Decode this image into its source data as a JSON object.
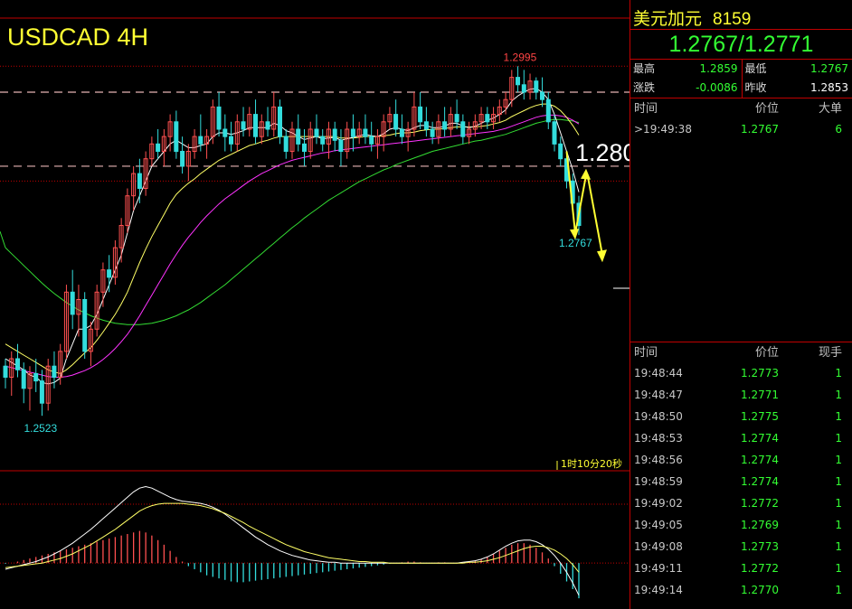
{
  "chart_title": "USDCAD 4H",
  "panel": {
    "name": "美元加元",
    "code": "8159",
    "price": "1.2767/1.2771",
    "stats": [
      [
        {
          "label": "最高",
          "value": "1.2859",
          "color": "green"
        },
        {
          "label": "最低",
          "value": "1.2767",
          "color": "green"
        }
      ],
      [
        {
          "label": "涨跌",
          "value": "-0.0086",
          "color": "green"
        },
        {
          "label": "昨收",
          "value": "1.2853",
          "color": "white"
        }
      ]
    ],
    "quote_header": [
      "时间",
      "价位",
      "大单"
    ],
    "quote_rows": [
      {
        "time": ">19:49:38",
        "price": "1.2767",
        "vol": "6"
      }
    ],
    "tick_header": [
      "时间",
      "价位",
      "现手"
    ],
    "ticks": [
      {
        "time": "19:48:44",
        "price": "1.2773",
        "vol": "1"
      },
      {
        "time": "19:48:47",
        "price": "1.2771",
        "vol": "1"
      },
      {
        "time": "19:48:50",
        "price": "1.2775",
        "vol": "1"
      },
      {
        "time": "19:48:53",
        "price": "1.2774",
        "vol": "1"
      },
      {
        "time": "19:48:56",
        "price": "1.2774",
        "vol": "1"
      },
      {
        "time": "19:48:59",
        "price": "1.2774",
        "vol": "1"
      },
      {
        "time": "19:49:02",
        "price": "1.2772",
        "vol": "1"
      },
      {
        "time": "19:49:05",
        "price": "1.2769",
        "vol": "1"
      },
      {
        "time": "19:49:08",
        "price": "1.2773",
        "vol": "1"
      },
      {
        "time": "19:49:11",
        "price": "1.2772",
        "vol": "1"
      },
      {
        "time": "19:49:14",
        "price": "1.2770",
        "vol": "1"
      }
    ]
  },
  "chart_data": {
    "type": "candlestick",
    "symbol": "USDCAD",
    "timeframe": "4H",
    "ylim": [
      1.245,
      1.306
    ],
    "high_label": "1.2995",
    "low_label": "1.2523",
    "last_label": "1.2767",
    "level_label": "1.2800",
    "countdown": "1时10分20秒",
    "levels": [
      1.296,
      1.286
    ],
    "ref_line": 1.284,
    "colors": {
      "up": "#ff5050",
      "down": "#33dddd",
      "ma_fast": "#ffffff",
      "ma_mid": "#ffff66",
      "ma_slow": "#ff33ff",
      "ma_long": "#33dd33",
      "grid": "#c00000",
      "level": "#e6b3b3",
      "arrow": "#ffff33"
    },
    "candles": [
      [
        1.259,
        1.26,
        1.256,
        1.2575
      ],
      [
        1.2575,
        1.261,
        1.255,
        1.26
      ],
      [
        1.26,
        1.262,
        1.2575,
        1.2585
      ],
      [
        1.2585,
        1.2595,
        1.254,
        1.256
      ],
      [
        1.256,
        1.259,
        1.253,
        1.258
      ],
      [
        1.258,
        1.26,
        1.2555,
        1.257
      ],
      [
        1.257,
        1.2585,
        1.2523,
        1.254
      ],
      [
        1.254,
        1.26,
        1.253,
        1.259
      ],
      [
        1.259,
        1.261,
        1.256,
        1.2575
      ],
      [
        1.2575,
        1.262,
        1.2565,
        1.261
      ],
      [
        1.261,
        1.27,
        1.26,
        1.269
      ],
      [
        1.269,
        1.272,
        1.264,
        1.266
      ],
      [
        1.266,
        1.27,
        1.263,
        1.268
      ],
      [
        1.268,
        1.269,
        1.26,
        1.261
      ],
      [
        1.261,
        1.265,
        1.259,
        1.264
      ],
      [
        1.264,
        1.27,
        1.263,
        1.269
      ],
      [
        1.269,
        1.273,
        1.267,
        1.272
      ],
      [
        1.272,
        1.274,
        1.269,
        1.271
      ],
      [
        1.271,
        1.276,
        1.27,
        1.275
      ],
      [
        1.275,
        1.279,
        1.273,
        1.278
      ],
      [
        1.278,
        1.283,
        1.277,
        1.282
      ],
      [
        1.282,
        1.286,
        1.28,
        1.285
      ],
      [
        1.285,
        1.287,
        1.281,
        1.283
      ],
      [
        1.283,
        1.288,
        1.282,
        1.287
      ],
      [
        1.287,
        1.29,
        1.286,
        1.289
      ],
      [
        1.289,
        1.291,
        1.287,
        1.288
      ],
      [
        1.288,
        1.291,
        1.286,
        1.29
      ],
      [
        1.29,
        1.293,
        1.288,
        1.292
      ],
      [
        1.292,
        1.2935,
        1.287,
        1.288
      ],
      [
        1.288,
        1.29,
        1.285,
        1.286
      ],
      [
        1.286,
        1.289,
        1.284,
        1.288
      ],
      [
        1.288,
        1.291,
        1.287,
        1.29
      ],
      [
        1.29,
        1.293,
        1.288,
        1.289
      ],
      [
        1.289,
        1.291,
        1.287,
        1.29
      ],
      [
        1.29,
        1.295,
        1.289,
        1.294
      ],
      [
        1.294,
        1.296,
        1.29,
        1.291
      ],
      [
        1.291,
        1.293,
        1.288,
        1.29
      ],
      [
        1.29,
        1.292,
        1.288,
        1.289
      ],
      [
        1.289,
        1.293,
        1.288,
        1.292
      ],
      [
        1.292,
        1.294,
        1.29,
        1.291
      ],
      [
        1.291,
        1.294,
        1.29,
        1.293
      ],
      [
        1.293,
        1.295,
        1.289,
        1.29
      ],
      [
        1.29,
        1.293,
        1.289,
        1.292
      ],
      [
        1.292,
        1.294,
        1.29,
        1.291
      ],
      [
        1.291,
        1.296,
        1.29,
        1.294
      ],
      [
        1.294,
        1.295,
        1.289,
        1.29
      ],
      [
        1.29,
        1.291,
        1.287,
        1.288
      ],
      [
        1.288,
        1.292,
        1.287,
        1.291
      ],
      [
        1.291,
        1.293,
        1.288,
        1.289
      ],
      [
        1.289,
        1.291,
        1.286,
        1.288
      ],
      [
        1.288,
        1.292,
        1.287,
        1.291
      ],
      [
        1.291,
        1.293,
        1.289,
        1.29
      ],
      [
        1.29,
        1.291,
        1.288,
        1.289
      ],
      [
        1.289,
        1.292,
        1.287,
        1.291
      ],
      [
        1.291,
        1.292,
        1.288,
        1.2895
      ],
      [
        1.2895,
        1.291,
        1.286,
        1.288
      ],
      [
        1.288,
        1.292,
        1.287,
        1.291
      ],
      [
        1.291,
        1.293,
        1.288,
        1.29
      ],
      [
        1.29,
        1.292,
        1.289,
        1.291
      ],
      [
        1.291,
        1.293,
        1.289,
        1.29
      ],
      [
        1.29,
        1.292,
        1.288,
        1.289
      ],
      [
        1.289,
        1.291,
        1.287,
        1.29
      ],
      [
        1.29,
        1.293,
        1.288,
        1.292
      ],
      [
        1.292,
        1.294,
        1.291,
        1.293
      ],
      [
        1.293,
        1.295,
        1.29,
        1.291
      ],
      [
        1.291,
        1.293,
        1.289,
        1.29
      ],
      [
        1.29,
        1.292,
        1.288,
        1.291
      ],
      [
        1.291,
        1.296,
        1.29,
        1.294
      ],
      [
        1.294,
        1.296,
        1.291,
        1.292
      ],
      [
        1.292,
        1.294,
        1.29,
        1.291
      ],
      [
        1.291,
        1.292,
        1.289,
        1.29
      ],
      [
        1.29,
        1.293,
        1.289,
        1.292
      ],
      [
        1.292,
        1.294,
        1.29,
        1.291
      ],
      [
        1.291,
        1.294,
        1.29,
        1.293
      ],
      [
        1.293,
        1.295,
        1.291,
        1.292
      ],
      [
        1.292,
        1.293,
        1.289,
        1.29
      ],
      [
        1.29,
        1.292,
        1.289,
        1.291
      ],
      [
        1.291,
        1.293,
        1.29,
        1.292
      ],
      [
        1.292,
        1.294,
        1.291,
        1.293
      ],
      [
        1.293,
        1.294,
        1.291,
        1.292
      ],
      [
        1.292,
        1.294,
        1.291,
        1.293
      ],
      [
        1.293,
        1.295,
        1.292,
        1.294
      ],
      [
        1.294,
        1.296,
        1.293,
        1.295
      ],
      [
        1.295,
        1.299,
        1.294,
        1.298
      ],
      [
        1.298,
        1.2995,
        1.296,
        1.297
      ],
      [
        1.297,
        1.299,
        1.295,
        1.296
      ],
      [
        1.296,
        1.2985,
        1.295,
        1.2975
      ],
      [
        1.2975,
        1.298,
        1.295,
        1.296
      ],
      [
        1.296,
        1.298,
        1.294,
        1.295
      ],
      [
        1.295,
        1.296,
        1.291,
        1.292
      ],
      [
        1.292,
        1.293,
        1.288,
        1.289
      ],
      [
        1.289,
        1.29,
        1.286,
        1.287
      ],
      [
        1.287,
        1.288,
        1.283,
        1.284
      ],
      [
        1.284,
        1.285,
        1.28,
        1.281
      ],
      [
        1.281,
        1.282,
        1.2767,
        1.278
      ]
    ],
    "ma_fast": [
      1.26,
      1.2595,
      1.259,
      1.2585,
      1.2578,
      1.2575,
      1.2568,
      1.2566,
      1.2568,
      1.2574,
      1.26,
      1.262,
      1.264,
      1.264,
      1.2645,
      1.266,
      1.268,
      1.27,
      1.272,
      1.274,
      1.277,
      1.28,
      1.282,
      1.284,
      1.286,
      1.287,
      1.288,
      1.289,
      1.2895,
      1.289,
      1.2885,
      1.2885,
      1.2888,
      1.289,
      1.29,
      1.2905,
      1.2905,
      1.2903,
      1.2905,
      1.2908,
      1.2912,
      1.2912,
      1.2912,
      1.2912,
      1.2918,
      1.2915,
      1.2908,
      1.2905,
      1.29,
      1.2896,
      1.2898,
      1.29,
      1.2897,
      1.2898,
      1.2899,
      1.2895,
      1.2897,
      1.2899,
      1.2901,
      1.2903,
      1.2901,
      1.29,
      1.2904,
      1.291,
      1.2912,
      1.291,
      1.2908,
      1.2912,
      1.2915,
      1.2915,
      1.2912,
      1.2912,
      1.2914,
      1.2918,
      1.2918,
      1.2914,
      1.2912,
      1.2914,
      1.2918,
      1.2922,
      1.2925,
      1.293,
      1.2936,
      1.2948,
      1.2955,
      1.296,
      1.2964,
      1.2965,
      1.296,
      1.295,
      1.293,
      1.2905,
      1.288,
      1.2855,
      1.2825
    ],
    "ma_mid": [
      1.262,
      1.2615,
      1.261,
      1.2605,
      1.26,
      1.2595,
      1.259,
      1.2585,
      1.2582,
      1.258,
      1.2585,
      1.2592,
      1.26,
      1.2608,
      1.2615,
      1.2625,
      1.2636,
      1.2648,
      1.266,
      1.2674,
      1.269,
      1.271,
      1.273,
      1.2748,
      1.2765,
      1.278,
      1.2795,
      1.281,
      1.2822,
      1.283,
      1.2837,
      1.2843,
      1.285,
      1.2856,
      1.2862,
      1.2868,
      1.2872,
      1.2876,
      1.288,
      1.2884,
      1.2888,
      1.289,
      1.2893,
      1.2895,
      1.2898,
      1.29,
      1.29,
      1.29,
      1.29,
      1.29,
      1.29,
      1.29,
      1.29,
      1.29,
      1.29,
      1.2898,
      1.2898,
      1.2898,
      1.2899,
      1.29,
      1.29,
      1.29,
      1.2901,
      1.2902,
      1.2904,
      1.2905,
      1.2905,
      1.2906,
      1.2908,
      1.2909,
      1.291,
      1.291,
      1.2911,
      1.2912,
      1.2913,
      1.2913,
      1.2913,
      1.2913,
      1.2914,
      1.2915,
      1.2917,
      1.2919,
      1.2922,
      1.2927,
      1.2931,
      1.2935,
      1.2939,
      1.2942,
      1.2944,
      1.2944,
      1.2941,
      1.2935,
      1.2926,
      1.2915,
      1.2902
    ],
    "ma_slow": [
      1.259,
      1.2588,
      1.2586,
      1.2584,
      1.2582,
      1.258,
      1.2578,
      1.2576,
      1.2575,
      1.2575,
      1.2576,
      1.2578,
      1.2581,
      1.2584,
      1.2588,
      1.2593,
      1.2599,
      1.2606,
      1.2614,
      1.2623,
      1.2633,
      1.2645,
      1.2658,
      1.2672,
      1.2686,
      1.27,
      1.2714,
      1.2728,
      1.2741,
      1.2753,
      1.2764,
      1.2774,
      1.2784,
      1.2793,
      1.2801,
      1.2809,
      1.2816,
      1.2822,
      1.2828,
      1.2834,
      1.284,
      1.2845,
      1.285,
      1.2854,
      1.2858,
      1.2862,
      1.2865,
      1.2868,
      1.287,
      1.2872,
      1.2874,
      1.2876,
      1.2878,
      1.2879,
      1.2881,
      1.2882,
      1.2883,
      1.2884,
      1.2885,
      1.2886,
      1.2887,
      1.2888,
      1.2889,
      1.289,
      1.2891,
      1.2892,
      1.2893,
      1.2894,
      1.2895,
      1.2896,
      1.2897,
      1.2898,
      1.2899,
      1.29,
      1.2901,
      1.2902,
      1.2903,
      1.2904,
      1.2905,
      1.2906,
      1.2907,
      1.2909,
      1.2911,
      1.2914,
      1.2917,
      1.292,
      1.2923,
      1.2926,
      1.2928,
      1.2929,
      1.2929,
      1.2928,
      1.2926,
      1.2922,
      1.2917
    ],
    "ma_long": [
      1.275,
      1.2742,
      1.2734,
      1.2726,
      1.2718,
      1.271,
      1.2702,
      1.2695,
      1.2688,
      1.2682,
      1.2676,
      1.2671,
      1.2666,
      1.2662,
      1.2658,
      1.2655,
      1.2652,
      1.265,
      1.2648,
      1.2647,
      1.2646,
      1.2646,
      1.2646,
      1.2647,
      1.2648,
      1.265,
      1.2652,
      1.2655,
      1.2658,
      1.2662,
      1.2666,
      1.2671,
      1.2676,
      1.2682,
      1.2688,
      1.2694,
      1.27,
      1.2707,
      1.2714,
      1.2721,
      1.2728,
      1.2735,
      1.2742,
      1.2749,
      1.2756,
      1.2763,
      1.277,
      1.2777,
      1.2783,
      1.279,
      1.2796,
      1.2802,
      1.2808,
      1.2814,
      1.2819,
      1.2824,
      1.2829,
      1.2834,
      1.2839,
      1.2843,
      1.2847,
      1.2851,
      1.2855,
      1.2858,
      1.2862,
      1.2865,
      1.2868,
      1.2871,
      1.2874,
      1.2877,
      1.288,
      1.2882,
      1.2884,
      1.2886,
      1.2888,
      1.289,
      1.2892,
      1.2894,
      1.2895,
      1.2897,
      1.2899,
      1.2901,
      1.2903,
      1.2906,
      1.2909,
      1.2912,
      1.2915,
      1.2918,
      1.292,
      1.2922,
      1.2923,
      1.2923,
      1.2922,
      1.2921,
      1.2919
    ],
    "macd_ylim": [
      -0.006,
      0.011
    ],
    "macd_hist": [
      -0.0001,
      0.0,
      0.0002,
      0.0004,
      0.0006,
      0.0008,
      0.001,
      0.0012,
      0.0014,
      0.0016,
      0.0018,
      0.002,
      0.0022,
      0.0024,
      0.0026,
      0.0028,
      0.003,
      0.0032,
      0.0034,
      0.0036,
      0.0038,
      0.004,
      0.0042,
      0.004,
      0.0036,
      0.003,
      0.0024,
      0.0016,
      0.0008,
      0.0002,
      -0.0004,
      -0.0008,
      -0.0012,
      -0.0016,
      -0.0018,
      -0.002,
      -0.0022,
      -0.0024,
      -0.0025,
      -0.0025,
      -0.0024,
      -0.0023,
      -0.0022,
      -0.0021,
      -0.002,
      -0.0019,
      -0.0018,
      -0.0017,
      -0.0016,
      -0.0015,
      -0.0014,
      -0.0013,
      -0.0012,
      -0.0011,
      -0.001,
      -0.0009,
      -0.0008,
      -0.0007,
      -0.0006,
      -0.0005,
      -0.0004,
      -0.0003,
      -0.0002,
      -0.0001,
      0.0,
      0.0001,
      0.0002,
      0.0002,
      0.0001,
      0.0,
      0.0,
      0.0001,
      0.0001,
      0.0,
      0.0,
      0.0001,
      0.0002,
      0.0003,
      0.0005,
      0.0008,
      0.0012,
      0.0016,
      0.002,
      0.0024,
      0.0026,
      0.0026,
      0.0024,
      0.002,
      0.0014,
      0.0006,
      -0.0004,
      -0.0014,
      -0.0024,
      -0.0034,
      -0.0046
    ],
    "macd_dif": [
      -0.0008,
      -0.0006,
      -0.0004,
      -0.0002,
      0.0,
      0.0002,
      0.0005,
      0.0008,
      0.0012,
      0.0016,
      0.0021,
      0.0026,
      0.0032,
      0.0038,
      0.0044,
      0.0051,
      0.0058,
      0.0065,
      0.0072,
      0.0079,
      0.0086,
      0.0093,
      0.0098,
      0.01,
      0.0098,
      0.0094,
      0.009,
      0.0086,
      0.0083,
      0.0081,
      0.008,
      0.0079,
      0.0078,
      0.0076,
      0.0073,
      0.0069,
      0.0064,
      0.0058,
      0.0052,
      0.0046,
      0.004,
      0.0034,
      0.0029,
      0.0024,
      0.002,
      0.0016,
      0.0013,
      0.001,
      0.0008,
      0.0006,
      0.0004,
      0.0003,
      0.0002,
      0.0001,
      0.0001,
      0.0,
      0.0,
      0.0,
      0.0,
      0.0,
      0.0,
      0.0,
      0.0,
      0.0,
      0.0,
      0.0,
      0.0,
      0.0,
      0.0,
      0.0,
      0.0,
      0.0,
      0.0,
      0.0,
      0.0,
      0.0001,
      0.0002,
      0.0003,
      0.0005,
      0.0008,
      0.0012,
      0.0017,
      0.0022,
      0.0026,
      0.0029,
      0.003,
      0.003,
      0.0028,
      0.0024,
      0.0018,
      0.001,
      0.0,
      -0.0012,
      -0.0026,
      -0.0042
    ],
    "macd_dea": [
      -0.0006,
      -0.0005,
      -0.0004,
      -0.0003,
      -0.0002,
      -0.0001,
      0.0,
      0.0002,
      0.0004,
      0.0006,
      0.0009,
      0.0012,
      0.0016,
      0.002,
      0.0024,
      0.0029,
      0.0034,
      0.0039,
      0.0044,
      0.005,
      0.0056,
      0.0062,
      0.0068,
      0.0072,
      0.0075,
      0.0077,
      0.0078,
      0.0078,
      0.0078,
      0.0078,
      0.0077,
      0.0076,
      0.0075,
      0.0073,
      0.0071,
      0.0068,
      0.0065,
      0.0061,
      0.0057,
      0.0053,
      0.0048,
      0.0044,
      0.004,
      0.0036,
      0.0032,
      0.0028,
      0.0024,
      0.0021,
      0.0018,
      0.0015,
      0.0013,
      0.0011,
      0.0009,
      0.0007,
      0.0006,
      0.0005,
      0.0004,
      0.0003,
      0.0002,
      0.0002,
      0.0001,
      0.0001,
      0.0001,
      0.0,
      0.0,
      0.0,
      0.0,
      0.0,
      0.0,
      0.0,
      0.0,
      0.0,
      0.0,
      0.0,
      0.0,
      0.0,
      0.0001,
      0.0001,
      0.0002,
      0.0003,
      0.0005,
      0.0007,
      0.001,
      0.0013,
      0.0016,
      0.0019,
      0.0021,
      0.0022,
      0.0022,
      0.002,
      0.0017,
      0.0012,
      0.0006,
      -0.0002,
      -0.0012
    ]
  }
}
